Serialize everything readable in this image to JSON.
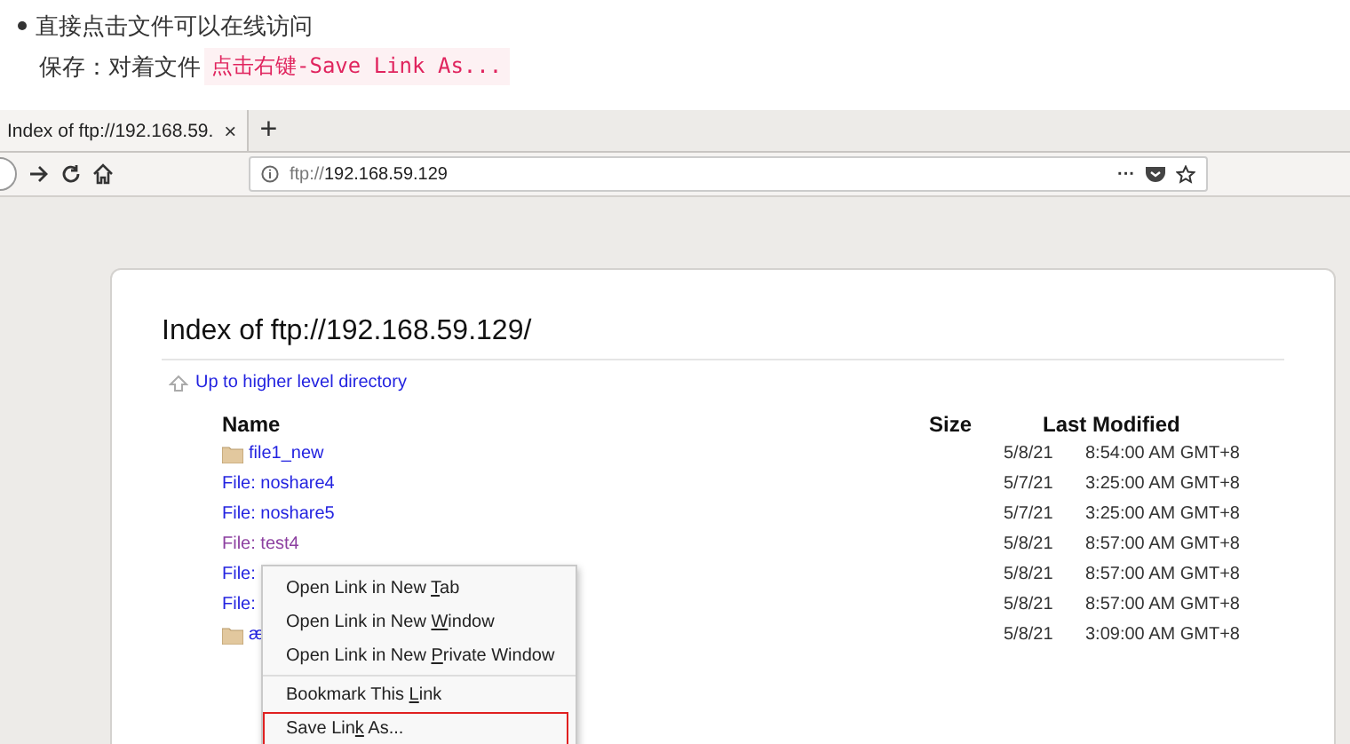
{
  "article": {
    "bullet": "直接点击文件可以在线访问",
    "save_line": "保存：对着文件",
    "code": "点击右键-Save Link As..."
  },
  "browser": {
    "tab": {
      "title": "Index of ftp://192.168.59.",
      "selected": true,
      "close": "×"
    },
    "new_tab": "+",
    "url": {
      "scheme": "ftp://",
      "host": "192.168.59.129"
    },
    "page_actions": "···",
    "page": {
      "title": "Index of ftp://192.168.59.129/",
      "up_link": "Up to higher level directory",
      "columns": [
        "Name",
        "Size",
        "Last Modified"
      ],
      "rows": [
        {
          "kind": "folder",
          "name": "file1_new",
          "visited": false,
          "date": "5/8/21",
          "time": "8:54:00 AM GMT+8"
        },
        {
          "kind": "file",
          "name": "File: noshare4",
          "visited": false,
          "date": "5/7/21",
          "time": "3:25:00 AM GMT+8"
        },
        {
          "kind": "file",
          "name": "File: noshare5",
          "visited": false,
          "date": "5/7/21",
          "time": "3:25:00 AM GMT+8"
        },
        {
          "kind": "file",
          "name": "File: test4",
          "visited": true,
          "date": "5/8/21",
          "time": "8:57:00 AM GMT+8"
        },
        {
          "kind": "file",
          "name": "File:",
          "visited": false,
          "date": "5/8/21",
          "time": "8:57:00 AM GMT+8"
        },
        {
          "kind": "file",
          "name": "File:",
          "visited": false,
          "date": "5/8/21",
          "time": "8:57:00 AM GMT+8"
        },
        {
          "kind": "folder",
          "name": "æ",
          "visited": false,
          "date": "5/8/21",
          "time": "3:09:00 AM GMT+8"
        }
      ]
    },
    "context_menu": [
      {
        "before": "Open Link in New ",
        "key": "T",
        "after": "ab",
        "separator_after": false,
        "highlighted": false
      },
      {
        "before": "Open Link in New ",
        "key": "W",
        "after": "indow",
        "separator_after": false,
        "highlighted": false
      },
      {
        "before": "Open Link in New ",
        "key": "P",
        "after": "rivate Window",
        "separator_after": true,
        "highlighted": false
      },
      {
        "before": "Bookmark This ",
        "key": "L",
        "after": "ink",
        "separator_after": false,
        "highlighted": false
      },
      {
        "before": "Save Lin",
        "key": "k",
        "after": " As...",
        "separator_after": false,
        "highlighted": true
      }
    ]
  }
}
